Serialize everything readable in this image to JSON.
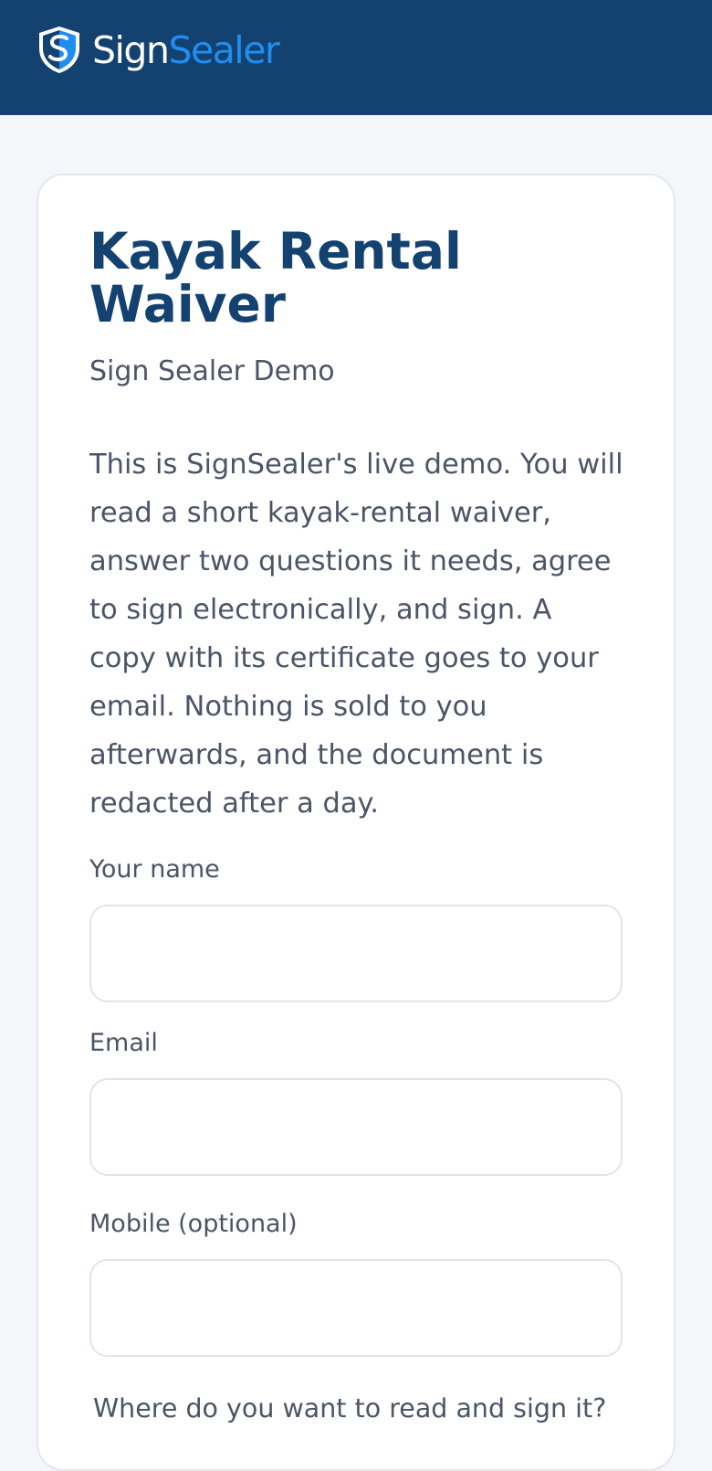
{
  "header": {
    "logo_icon": "shield-s-icon",
    "brand_part1": "Sign",
    "brand_part2": "Sealer",
    "colors": {
      "bar": "#134271",
      "brand_accent": "#1f8ef1"
    }
  },
  "card": {
    "title": "Kayak Rental Waiver",
    "subtitle": "Sign Sealer Demo",
    "intro": "This is SignSealer's live demo. You will read a short kayak-rental waiver, answer two questions it needs, agree to sign electronically, and sign. A copy with its certificate goes to your email. Nothing is sold to you afterwards, and the document is redacted after a day."
  },
  "form": {
    "name_label": "Your name",
    "name_value": "",
    "email_label": "Email",
    "email_value": "",
    "mobile_label": "Mobile (optional)",
    "mobile_value": "",
    "delivery_question": "Where do you want to read and sign it?"
  }
}
